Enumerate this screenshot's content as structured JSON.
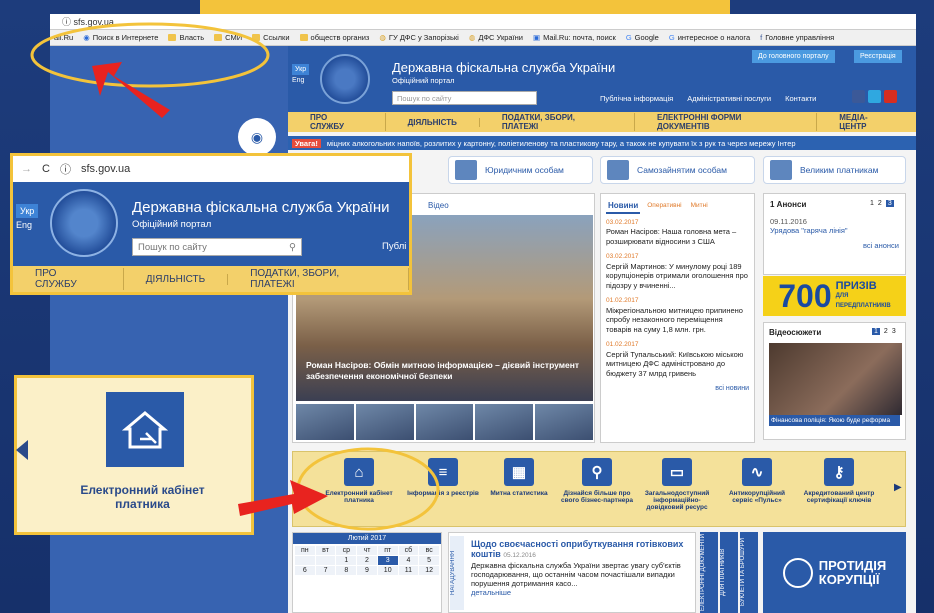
{
  "browser": {
    "url": "sfs.gov.ua",
    "bookmarks": [
      "ail.Ru",
      "Поиск в Интернете",
      "Власть",
      "СМИ",
      "Ссылки",
      "обществ организ",
      "ГУ ДФС у Запорізькі",
      "ДФС України",
      "Mail.Ru: почта, поиск",
      "Google",
      "интересное о налога",
      "Головне управління"
    ]
  },
  "site": {
    "lang_active": "Укр",
    "lang_other": "Eng",
    "title": "Державна фіскальна служба України",
    "subtitle": "Офіційний портал",
    "search_placeholder": "Пошук по сайту",
    "top_links": [
      "Публічна інформація",
      "Адміністративні послуги",
      "Контакти"
    ],
    "btn_main_portal": "До головного порталу",
    "btn_register": "Реєстрація",
    "menu": [
      "ПРО СЛУЖБУ",
      "ДІЯЛЬНІСТЬ",
      "ПОДАТКИ, ЗБОРИ, ПЛАТЕЖІ",
      "ЕЛЕКТРОННІ ФОРМИ ДОКУМЕНТІВ",
      "МЕДІА-ЦЕНТР"
    ],
    "alert_badge": "Увага!",
    "alert_text": "міцних алкогольних напоїв, розлитих у картонну, поліетиленову та пластикову тару, а також не купувати їх з рук та через мережу Інтер",
    "categories": [
      "Юридичним особам",
      "Самозайнятим особам",
      "Великим платникам"
    ]
  },
  "main": {
    "tab_video": "Відео",
    "photo_caption": "Роман Насіров: Обмін митною інформацією – дієвий інструмент забезпечення економічної безпеки"
  },
  "news": {
    "tab_main": "Новини",
    "tab_op": "Оперативні",
    "tab_customs": "Митні",
    "items": [
      {
        "date": "03.02.2017",
        "text": "Роман Насіров: Наша головна мета – розширювати відносини з США"
      },
      {
        "date": "03.02.2017",
        "text": "Сергій Мартинов: У минулому році 189 корупціонерів отримали оголошення про підозру у вчиненні..."
      },
      {
        "date": "01.02.2017",
        "text": "Міжрегіональною митницею припинено спробу незаконного переміщення товарів на суму 1,8 млн. грн."
      },
      {
        "date": "01.02.2017",
        "text": "Сергій Тупальський: Київською міською митницею ДФС адміністровано до бюджету 37 млрд гривень"
      }
    ],
    "all": "всі новини"
  },
  "announce": {
    "title": "1 Анонси",
    "pages": [
      "1",
      "2",
      "3"
    ],
    "date": "09.11.2016",
    "link": "Урядова \"гаряча лінія\"",
    "all": "всі анонси"
  },
  "promo": {
    "number": "700",
    "word": "ПРИЗІВ",
    "sub1": "ДЛЯ",
    "sub2": "ПЕРЕДПЛАТНИКІВ"
  },
  "video": {
    "title": "Відеосюжети",
    "pages": [
      "1",
      "2",
      "3"
    ],
    "caption": "Фінансова поліція: Якою буде реформа"
  },
  "services": [
    {
      "label": "Електронний кабінет платника",
      "icon": "⌂"
    },
    {
      "label": "Інформація з реєстрів",
      "icon": "≡"
    },
    {
      "label": "Митна статистика",
      "icon": "▦"
    },
    {
      "label": "Дізнайся більше про свого бізнес-партнера",
      "icon": "⚲"
    },
    {
      "label": "Загальнодоступний інформаційно-довідковий ресурс",
      "icon": "▭"
    },
    {
      "label": "Антикорупційний сервіс «Пульс»",
      "icon": "∿"
    },
    {
      "label": "Акредитований центр сертифікації ключів",
      "icon": "⚷"
    }
  ],
  "calendar": {
    "month": "Лютий 2017",
    "weekdays": [
      "пн",
      "вт",
      "ср",
      "чт",
      "пт",
      "сб",
      "вс"
    ],
    "days": [
      "",
      "",
      "1",
      "2",
      "3",
      "4",
      "5",
      "6",
      "7",
      "8",
      "9",
      "10",
      "11",
      "12"
    ],
    "today": "3"
  },
  "reminder": {
    "side": "НАГАДУВАННЯ",
    "title": "Щодо своєчасності оприбуткування готівкових коштів",
    "date": "05.12.2016",
    "text": "Державна фіскальна служба України звертає увагу суб'єктів господарювання, що останнім часом почастішали випадки порушення дотримання касо...",
    "more": "детальніше",
    "vert1": "ЕЛЕКТРОННІ ДОКУМЕНТИ",
    "vert2": "ДЛЯ ПЛАТНИКІВ",
    "vert3": "БУКЛЕТИ ТА БРОШУРИ"
  },
  "corruption": {
    "line1": "ПРОТИДІЯ",
    "line2": "КОРУПЦІЇ"
  },
  "zoom": {
    "url": "sfs.gov.ua",
    "publ": "Публі",
    "menu": [
      "ПРО СЛУЖБУ",
      "ДІЯЛЬНІСТЬ",
      "ПОДАТКИ, ЗБОРИ, ПЛАТЕЖІ"
    ]
  },
  "callout": {
    "text": "Електронний кабінет платника"
  },
  "colors": {
    "brand": "#2a5aa8",
    "accent": "#f3c33b",
    "arrow": "#e8231f"
  }
}
